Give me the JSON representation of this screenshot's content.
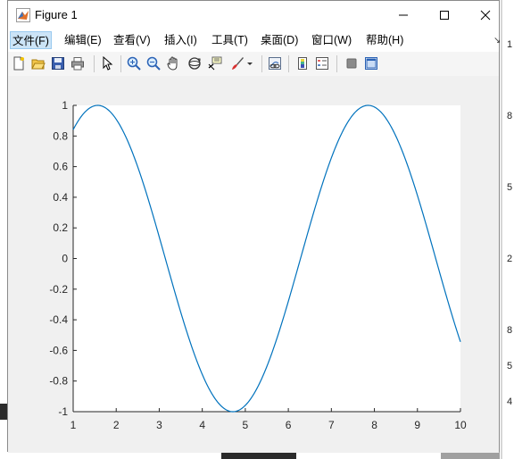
{
  "window": {
    "title": "Figure 1"
  },
  "menu": [
    {
      "label": "文件(F)"
    },
    {
      "label": "编辑(E)"
    },
    {
      "label": "查看(V)"
    },
    {
      "label": "插入(I)"
    },
    {
      "label": "工具(T)"
    },
    {
      "label": "桌面(D)"
    },
    {
      "label": "窗口(W)"
    },
    {
      "label": "帮助(H)"
    }
  ],
  "toolbar_icons": [
    "new-figure-icon",
    "open-file-icon",
    "save-icon",
    "print-icon",
    "pointer-icon",
    "zoom-in-icon",
    "zoom-out-icon",
    "pan-icon",
    "rotate-3d-icon",
    "data-cursor-icon",
    "brush-icon",
    "link-plot-icon",
    "colorbar-icon",
    "legend-icon",
    "hide-plot-tools-icon",
    "show-plot-tools-icon"
  ],
  "background_digits": [
    "1",
    "8",
    "5",
    "2",
    "8",
    "5",
    "4"
  ],
  "chart_data": {
    "type": "line",
    "function": "sin(x)",
    "x": [
      1,
      1.25,
      1.5,
      1.75,
      2,
      2.25,
      2.5,
      2.75,
      3,
      3.25,
      3.5,
      3.75,
      4,
      4.25,
      4.5,
      4.75,
      5,
      5.25,
      5.5,
      5.75,
      6,
      6.25,
      6.5,
      6.75,
      7,
      7.25,
      7.5,
      7.75,
      8,
      8.25,
      8.5,
      8.75,
      9,
      9.25,
      9.5,
      9.75,
      10
    ],
    "y": [
      0.841,
      0.949,
      0.997,
      0.984,
      0.909,
      0.778,
      0.598,
      0.382,
      0.141,
      -0.108,
      -0.351,
      -0.572,
      -0.757,
      -0.895,
      -0.978,
      -0.999,
      -0.959,
      -0.859,
      -0.706,
      -0.508,
      -0.279,
      -0.033,
      0.215,
      0.45,
      0.657,
      0.823,
      0.938,
      0.994,
      0.989,
      0.925,
      0.798,
      0.625,
      0.412,
      0.174,
      -0.075,
      -0.319,
      -0.544
    ],
    "xlim": [
      1,
      10
    ],
    "ylim": [
      -1,
      1
    ],
    "xticks": [
      "1",
      "2",
      "3",
      "4",
      "5",
      "6",
      "7",
      "8",
      "9",
      "10"
    ],
    "yticks": [
      "1",
      "0.8",
      "0.6",
      "0.4",
      "0.2",
      "0",
      "-0.2",
      "-0.4",
      "-0.6",
      "-0.8",
      "-1"
    ],
    "line_color": "#0072BD",
    "grid": false
  }
}
